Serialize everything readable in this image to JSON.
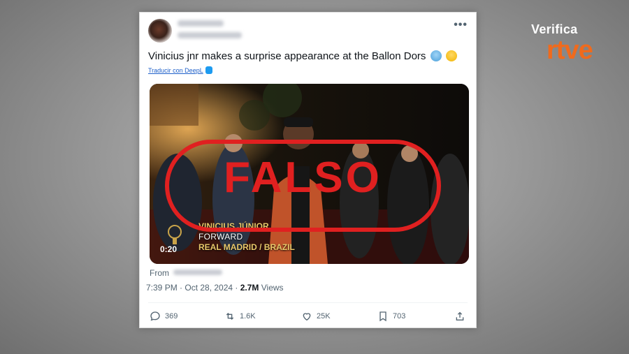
{
  "brand": {
    "top": "Verifica",
    "bottom": "rtve"
  },
  "tweet": {
    "text": "Vinicius jnr makes a surprise appearance at the Ballon Dors",
    "translate_label": "Traducir con DeepL",
    "video": {
      "duration": "0:20",
      "caption_name": "VINICIUS JÚNIOR",
      "caption_position": "FORWARD",
      "caption_team": "REAL MADRID / BRAZIL",
      "stamp": "FALSO",
      "stamp_color": "#e02020"
    },
    "from_label": "From",
    "time": "7:39 PM · Oct 28, 2024 · ",
    "views_count": "2.7M",
    "views_label": " Views",
    "actions": {
      "replies": "369",
      "reposts": "1.6K",
      "likes": "25K",
      "bookmarks": "703"
    }
  },
  "colors": {
    "accent": "#1d9bf0",
    "brand_orange": "#f06a1c"
  }
}
